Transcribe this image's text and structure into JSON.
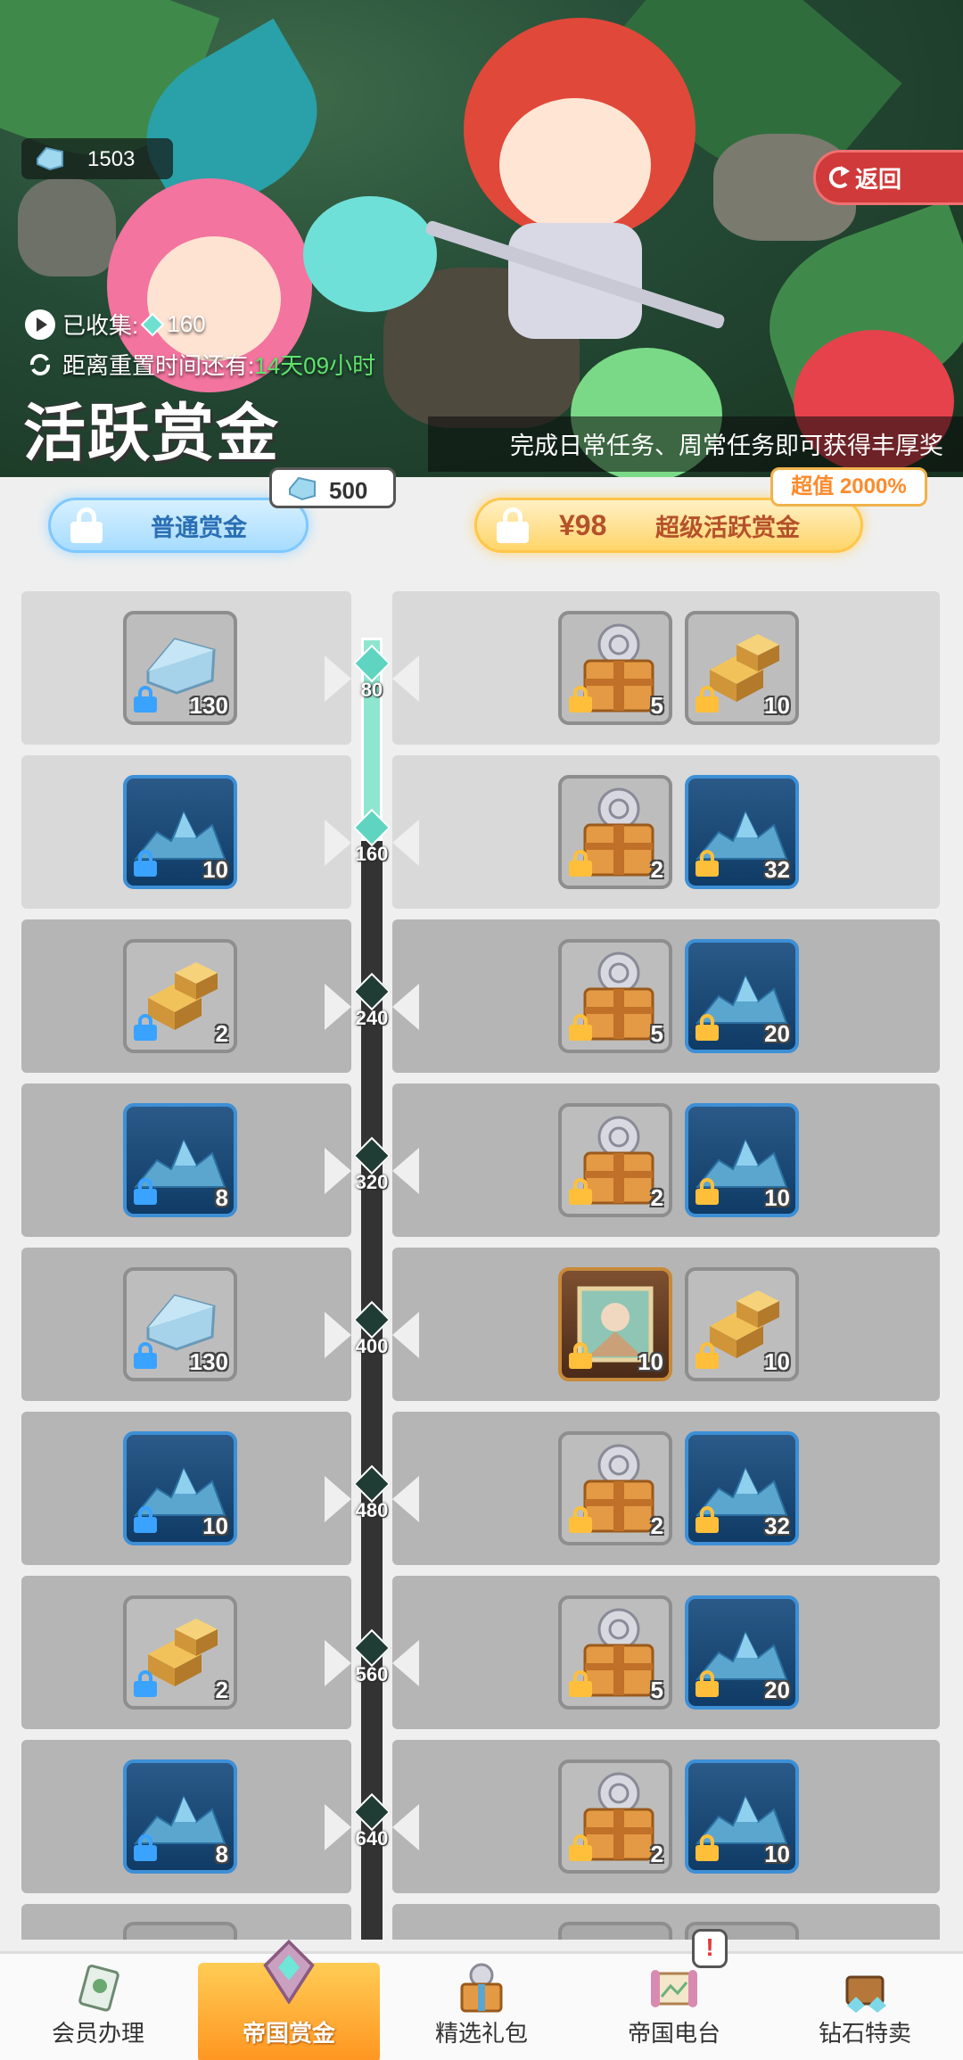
{
  "header": {
    "gem_balance": "1503",
    "back_label": "返回",
    "collected_label": "已收集:",
    "collected_value": "160",
    "reset_label": "距离重置时间还有:",
    "reset_value": "14天09小时",
    "title": "活跃赏金",
    "subtitle": "完成日常任务、周常任务即可获得丰厚奖"
  },
  "tabs": {
    "normal_label": "普通赏金",
    "normal_price": "500",
    "super_price": "¥98",
    "super_label": "超级活跃赏金",
    "super_badge": "超值 2000%"
  },
  "levels": [
    {
      "value": "80",
      "reached": true,
      "free": {
        "icon": "crystal-icon",
        "qty": "130"
      },
      "premium": [
        {
          "icon": "chest-icon",
          "qty": "5"
        },
        {
          "icon": "gold-blocks-icon",
          "qty": "10"
        }
      ]
    },
    {
      "value": "160",
      "reached": true,
      "free": {
        "icon": "ore-pile-icon",
        "qty": "10"
      },
      "premium": [
        {
          "icon": "chest-icon",
          "qty": "2"
        },
        {
          "icon": "ore-pile-icon",
          "qty": "32"
        }
      ]
    },
    {
      "value": "240",
      "reached": false,
      "free": {
        "icon": "gold-blocks-icon",
        "qty": "2"
      },
      "premium": [
        {
          "icon": "chest-icon",
          "qty": "5"
        },
        {
          "icon": "ore-pile-icon",
          "qty": "20"
        }
      ]
    },
    {
      "value": "320",
      "reached": false,
      "free": {
        "icon": "ore-pile-icon",
        "qty": "8"
      },
      "premium": [
        {
          "icon": "chest-icon",
          "qty": "2"
        },
        {
          "icon": "ore-pile-icon",
          "qty": "10"
        }
      ]
    },
    {
      "value": "400",
      "reached": false,
      "free": {
        "icon": "crystal-icon",
        "qty": "130"
      },
      "premium": [
        {
          "icon": "portrait-frame-icon",
          "qty": "10"
        },
        {
          "icon": "gold-blocks-icon",
          "qty": "10"
        }
      ]
    },
    {
      "value": "480",
      "reached": false,
      "free": {
        "icon": "ore-pile-icon",
        "qty": "10"
      },
      "premium": [
        {
          "icon": "chest-icon",
          "qty": "2"
        },
        {
          "icon": "ore-pile-icon",
          "qty": "32"
        }
      ]
    },
    {
      "value": "560",
      "reached": false,
      "free": {
        "icon": "gold-blocks-icon",
        "qty": "2"
      },
      "premium": [
        {
          "icon": "chest-icon",
          "qty": "5"
        },
        {
          "icon": "ore-pile-icon",
          "qty": "20"
        }
      ]
    },
    {
      "value": "640",
      "reached": false,
      "free": {
        "icon": "ore-pile-icon",
        "qty": "8"
      },
      "premium": [
        {
          "icon": "chest-icon",
          "qty": "2"
        },
        {
          "icon": "ore-pile-icon",
          "qty": "10"
        }
      ]
    }
  ],
  "nav": [
    {
      "label": "会员办理",
      "icon": "membership-card-icon",
      "active": false
    },
    {
      "label": "帝国赏金",
      "icon": "empire-bounty-icon",
      "active": true
    },
    {
      "label": "精选礼包",
      "icon": "gift-pack-icon",
      "active": false
    },
    {
      "label": "帝国电台",
      "icon": "scroll-icon",
      "active": false,
      "alert": "!"
    },
    {
      "label": "钻石特卖",
      "icon": "diamond-chest-icon",
      "active": false
    }
  ],
  "colors": {
    "track_reached": "#8fe6d0",
    "track_locked": "#333333",
    "node_reached": "#5fd4c1",
    "node_locked": "#1f3c35",
    "accent_orange": "#ff9520",
    "back_red": "#d03a3a"
  }
}
